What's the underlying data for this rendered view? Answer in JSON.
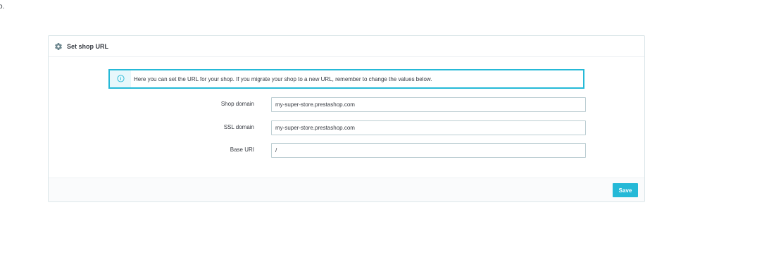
{
  "stray_text": "o.",
  "panel": {
    "title": "Set shop URL",
    "icon": "gear-icon"
  },
  "alert": {
    "icon": "info-icon",
    "text": "Here you can set the URL for your shop. If you migrate your shop to a new URL, remember to change the values below."
  },
  "form": {
    "shop_domain": {
      "label": "Shop domain",
      "value": "my-super-store.prestashop.com"
    },
    "ssl_domain": {
      "label": "SSL domain",
      "value": "my-super-store.prestashop.com"
    },
    "base_uri": {
      "label": "Base URI",
      "value": "/"
    }
  },
  "footer": {
    "save_label": "Save"
  },
  "colors": {
    "accent": "#25b9d7",
    "border": "#dbe6e9",
    "text": "#363a41"
  }
}
